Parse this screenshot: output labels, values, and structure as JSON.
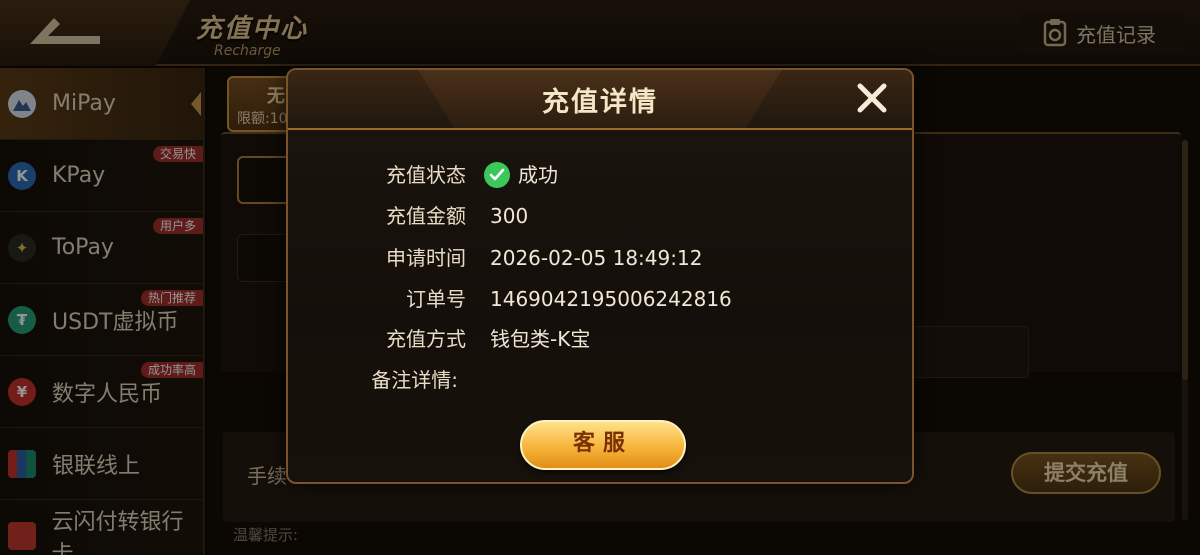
{
  "header": {
    "title_cn": "充值中心",
    "title_en": "Recharge",
    "record_label": "充值记录"
  },
  "sidebar": {
    "items": [
      {
        "label": "MiPay",
        "tag": "",
        "icon": "mipay-icon",
        "color": "#5b7fb0"
      },
      {
        "label": "KPay",
        "tag": "交易快",
        "icon": "kpay-icon",
        "color": "#4a84c9"
      },
      {
        "label": "ToPay",
        "tag": "用户多",
        "icon": "topay-icon",
        "color": "#2c2c2c"
      },
      {
        "label": "USDT虚拟币",
        "tag": "热门推荐",
        "icon": "usdt-icon",
        "color": "#26a17b"
      },
      {
        "label": "数字人民币",
        "tag": "成功率高",
        "icon": "ecny-icon",
        "color": "#c7312b"
      },
      {
        "label": "银联线上",
        "tag": "",
        "icon": "unionpay-icon",
        "color": "#2d5fa8"
      },
      {
        "label": "云闪付转银行卡",
        "tag": "",
        "icon": "quickpass-icon",
        "color": "#c23a2e"
      }
    ]
  },
  "main": {
    "card_title": "无",
    "card_limit": "限额:10",
    "fee_label": "手续",
    "submit_label": "提交充值",
    "hint_label": "温馨提示:"
  },
  "modal": {
    "title": "充值详情",
    "rows": [
      {
        "label": "充值状态",
        "value": "成功"
      },
      {
        "label": "充值金额",
        "value": "300"
      },
      {
        "label": "申请时间",
        "value": "2026-02-05 18:49:12"
      },
      {
        "label": "订单号",
        "value": "1469042195006242816"
      },
      {
        "label": "充值方式",
        "value": "钱包类-K宝"
      },
      {
        "label": "备注详情:",
        "value": ""
      }
    ],
    "service_label": "客服"
  },
  "colors": {
    "accent": "#c79a4a",
    "success": "#3cc75a",
    "button_gold": "#f6b43a"
  }
}
